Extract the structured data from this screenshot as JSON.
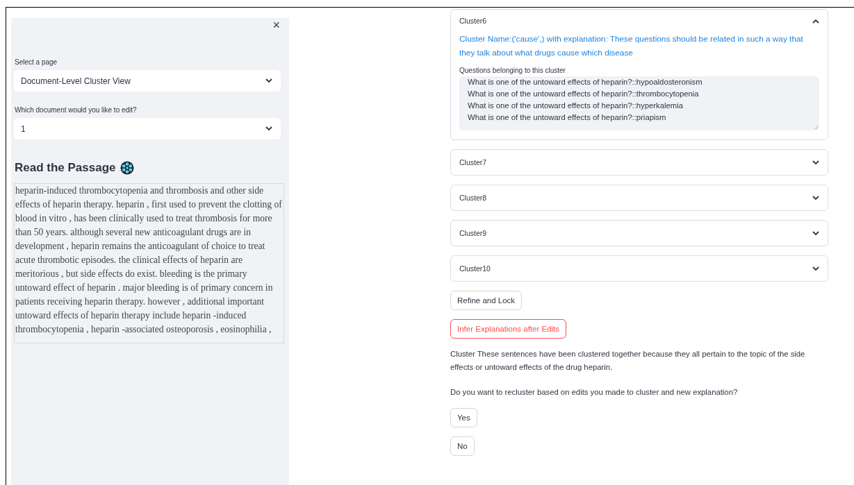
{
  "sidebar": {
    "close": "×",
    "fields": [
      {
        "label": "Select a page",
        "value": "Document-Level Cluster View"
      },
      {
        "label": "Which document would you like to edit?",
        "value": "1"
      }
    ],
    "heading": "Read the Passage",
    "passage": "heparin-induced thrombocytopenia and thrombosis and other side effects of heparin therapy. heparin , first used to prevent the clotting of blood in vitro , has been clinically used to treat thrombosis for more than 50 years. although several new anticoagulant drugs are in development , heparin remains the anticoagulant of choice to treat acute thrombotic episodes. the clinical effects of heparin are meritorious , but side effects do exist. bleeding is the primary untoward effect of heparin . major bleeding is of primary concern in patients receiving heparin therapy. however , additional important untoward effects of heparin therapy include heparin -induced thrombocytopenia , heparin -associated osteoporosis , eosinophilia ,"
  },
  "clusters": [
    {
      "title": "Cluster6",
      "expanded": true,
      "name": "Cluster Name:('cause',) with explanation: These questions should be related in such a way that they talk about what drugs cause which disease",
      "questions_label": "Questions belonging to this cluster",
      "questions": [
        "What is one of the untoward effects of heparin?::hypoaldosteronism",
        "What is one of the untoward effects of heparin?::thrombocytopenia",
        "What is one of the untoward effects of heparin?::hyperkalemia",
        "What is one of the untoward effects of heparin?::priapism"
      ]
    },
    {
      "title": "Cluster7",
      "expanded": false
    },
    {
      "title": "Cluster8",
      "expanded": false
    },
    {
      "title": "Cluster9",
      "expanded": false
    },
    {
      "title": "Cluster10",
      "expanded": false
    }
  ],
  "actions": [
    {
      "label": "Refine and Lock",
      "kind": "plain"
    },
    {
      "label": "Infer Explanations after Edits",
      "kind": "primary"
    }
  ],
  "explanation": "Cluster These sentences have been clustered together because they all pertain to the topic of the side effects or untoward effects of the drug heparin.",
  "question": "Do you want to recluster based on edits you made to cluster and new explanation?",
  "answers": [
    "Yes",
    "No"
  ]
}
